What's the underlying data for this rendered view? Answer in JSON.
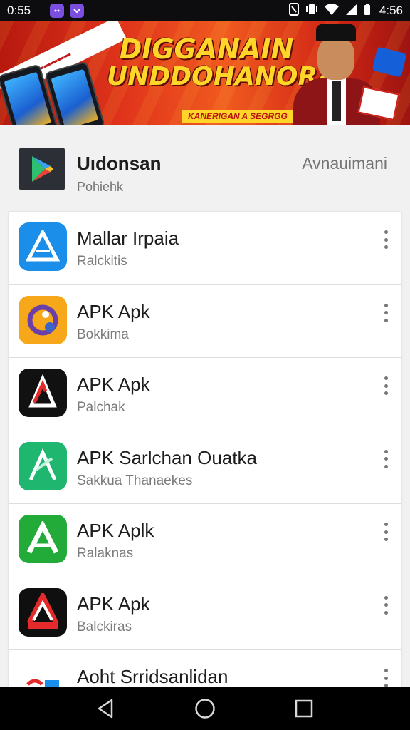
{
  "status_bar": {
    "time_left": "0:55",
    "time_right": "4:56"
  },
  "banner": {
    "headline_1": "DIGGANAIN",
    "headline_2": "UNDDOHANORA",
    "tagline": "KANERIGAN A SEGRGG"
  },
  "developer": {
    "name": "Uıdonsan",
    "subtitle": "Pohiehk",
    "action_label": "Avnauimani"
  },
  "apps": [
    {
      "title": "Mallar Irpaia",
      "subtitle": "Ralckitis",
      "icon": "blue-triangle-app-icon",
      "color": "#1a8ee8"
    },
    {
      "title": "APK Apk",
      "subtitle": "Bokkima",
      "icon": "orange-purple-app-icon",
      "color": "#f6a81a"
    },
    {
      "title": "APK Apk",
      "subtitle": "Palchak",
      "icon": "black-red-triangle-app-icon",
      "color": "#111111"
    },
    {
      "title": "APK Sarlchan Ouatka",
      "subtitle": "Sakkua Thanaekes",
      "icon": "green-triangle-app-icon",
      "color": "#1fb66f"
    },
    {
      "title": "APK Aplk",
      "subtitle": "Ralaknas",
      "icon": "green-a-app-icon",
      "color": "#23ab3a"
    },
    {
      "title": "APK Apk",
      "subtitle": "Balckiras",
      "icon": "black-red-a-app-icon",
      "color": "#0f0f0f"
    },
    {
      "title": "Aoht Srridsanlidan",
      "subtitle": "",
      "icon": "flag-app-icon",
      "color": "#ffffff"
    }
  ]
}
